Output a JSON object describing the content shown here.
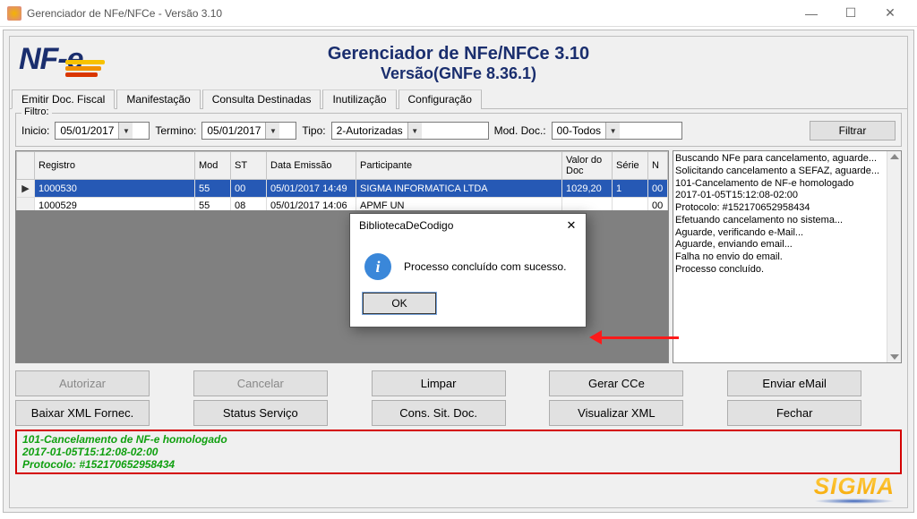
{
  "window": {
    "title": "Gerenciador de NFe/NFCe - Versão 3.10"
  },
  "header": {
    "logo_text": "NF-e",
    "title": "Gerenciador de NFe/NFCe 3.10",
    "subtitle": "Versão(GNFe 8.36.1)"
  },
  "tabs": {
    "items": [
      "Emitir Doc. Fiscal",
      "Manifestação",
      "Consulta Destinadas",
      "Inutilização",
      "Configuração"
    ],
    "active": 0
  },
  "filter": {
    "legend": "Filtro:",
    "inicio_label": "Inicio:",
    "inicio_value": "05/01/2017",
    "termino_label": "Termino:",
    "termino_value": "05/01/2017",
    "tipo_label": "Tipo:",
    "tipo_value": "2-Autorizadas",
    "moddoc_label": "Mod. Doc.:",
    "moddoc_value": "00-Todos",
    "filtrar_btn": "Filtrar"
  },
  "grid": {
    "columns": [
      "Registro",
      "Mod",
      "ST",
      "Data Emissão",
      "Participante",
      "Valor do Doc",
      "Série",
      "N"
    ],
    "rows": [
      {
        "registro": "1000530",
        "mod": "55",
        "st": "00",
        "data": "05/01/2017 14:49",
        "participante": "SIGMA INFORMATICA LTDA",
        "valor": "1029,20",
        "serie": "1",
        "n": "00",
        "selected": true
      },
      {
        "registro": "1000529",
        "mod": "55",
        "st": "08",
        "data": "05/01/2017 14:06",
        "participante": "APMF UN",
        "valor": "",
        "serie": "",
        "n": "00",
        "selected": false
      }
    ]
  },
  "log": {
    "lines": [
      "Buscando NFe para cancelamento, aguarde...",
      "Solicitando cancelamento a SEFAZ, aguarde...",
      "101-Cancelamento de NF-e homologado",
      "2017-01-05T15:12:08-02:00",
      "Protocolo: #152170652958434",
      "Efetuando cancelamento no sistema...",
      "Aguarde, verificando e-Mail...",
      "Aguarde, enviando email...",
      "Falha no envio do email.",
      "Processo concluído."
    ]
  },
  "buttons": {
    "row1": [
      "Autorizar",
      "Cancelar",
      "Limpar",
      "Gerar CCe",
      "Enviar eMail"
    ],
    "row2": [
      "Baixar XML Fornec.",
      "Status Serviço",
      "Cons. Sit. Doc.",
      "Visualizar XML",
      "Fechar"
    ],
    "disabled": [
      "Autorizar",
      "Cancelar"
    ]
  },
  "status": {
    "lines": [
      "101-Cancelamento de NF-e homologado",
      "2017-01-05T15:12:08-02:00",
      "Protocolo: #152170652958434"
    ]
  },
  "modal": {
    "title": "BibliotecaDeCodigo",
    "message": "Processo concluído com sucesso.",
    "ok": "OK"
  },
  "brand": {
    "sigma": "SIGMA"
  }
}
